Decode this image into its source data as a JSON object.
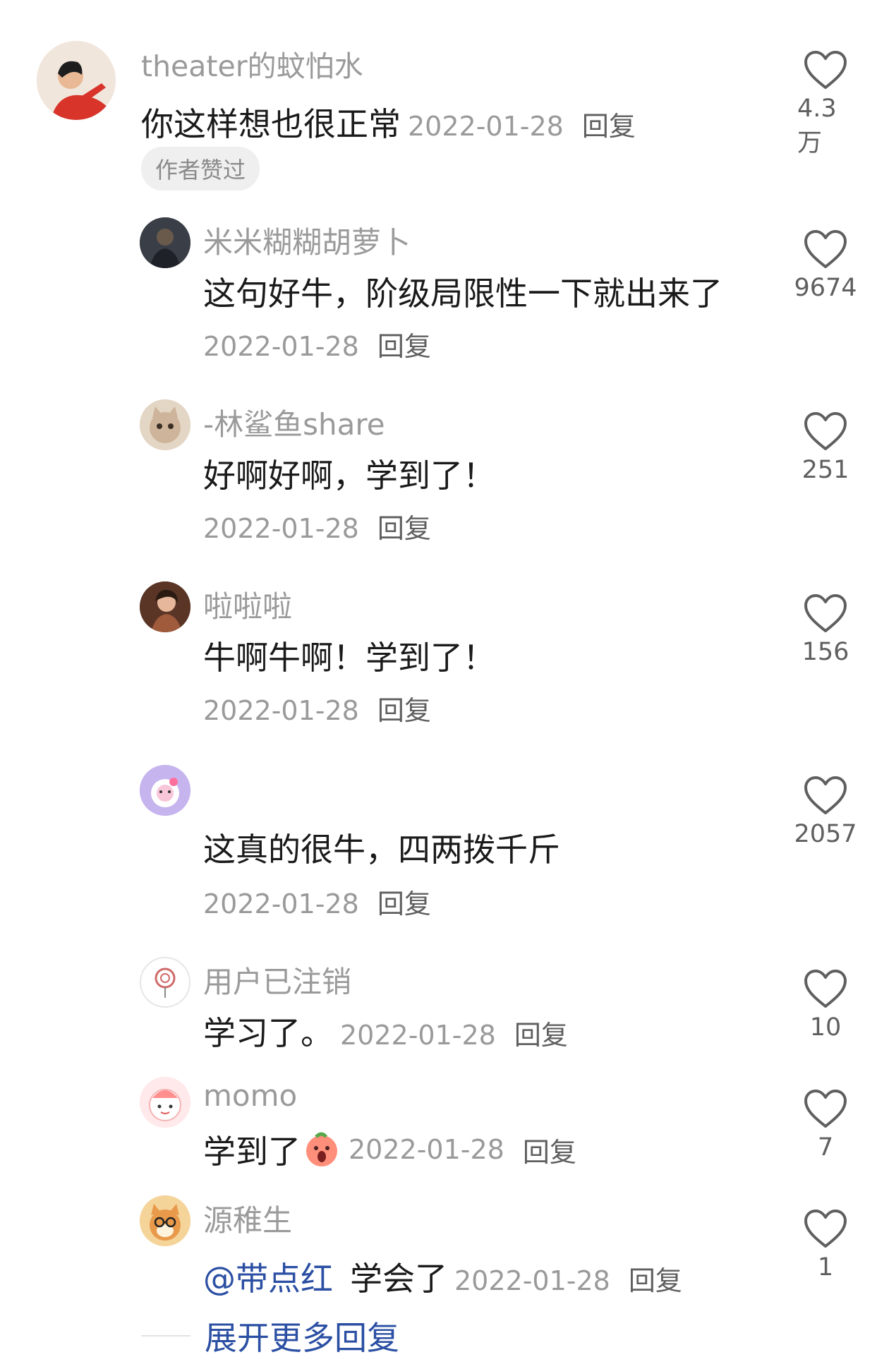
{
  "comments": [
    {
      "username": "theater的蚊怕水",
      "text": "你这样想也很正常",
      "date": "2022-01-28",
      "reply_label": "回复",
      "likes": "4.3万",
      "badge": "作者赞过",
      "avatar_icon": "person-photo-avatar"
    },
    {
      "username": "米米糊糊胡萝卜",
      "text": "这句好牛，阶级局限性一下就出来了",
      "date": "2022-01-28",
      "reply_label": "回复",
      "likes": "9674",
      "avatar_icon": "dark-photo-avatar"
    },
    {
      "username": "-林鲨鱼share",
      "text": "好啊好啊，学到了！",
      "date": "2022-01-28",
      "reply_label": "回复",
      "likes": "251",
      "avatar_icon": "cat-avatar"
    },
    {
      "username": "啦啦啦",
      "text": "牛啊牛啊！学到了！",
      "date": "2022-01-28",
      "reply_label": "回复",
      "likes": "156",
      "avatar_icon": "portrait-avatar"
    },
    {
      "username": "",
      "text": "这真的很牛，四两拨千斤",
      "date": "2022-01-28",
      "reply_label": "回复",
      "likes": "2057",
      "avatar_icon": "hello-kitty-avatar"
    },
    {
      "username": "用户已注销",
      "text": "学习了。",
      "date": "2022-01-28",
      "reply_label": "回复",
      "likes": "10",
      "avatar_icon": "lollipop-avatar"
    },
    {
      "username": "momo",
      "text": "学到了",
      "emoji_icon": "screaming-peach-emoji",
      "date": "2022-01-28",
      "reply_label": "回复",
      "likes": "7",
      "avatar_icon": "cartoon-bun-avatar"
    },
    {
      "username": "源稚生",
      "mention": "@带点红",
      "text": "学会了",
      "date": "2022-01-28",
      "reply_label": "回复",
      "likes": "1",
      "avatar_icon": "shiba-glasses-avatar"
    }
  ],
  "expand_more": "展开更多回复",
  "colors": {
    "accent": "#2b4fa3",
    "muted": "#9a9a9a",
    "text": "#1a1a1a"
  }
}
